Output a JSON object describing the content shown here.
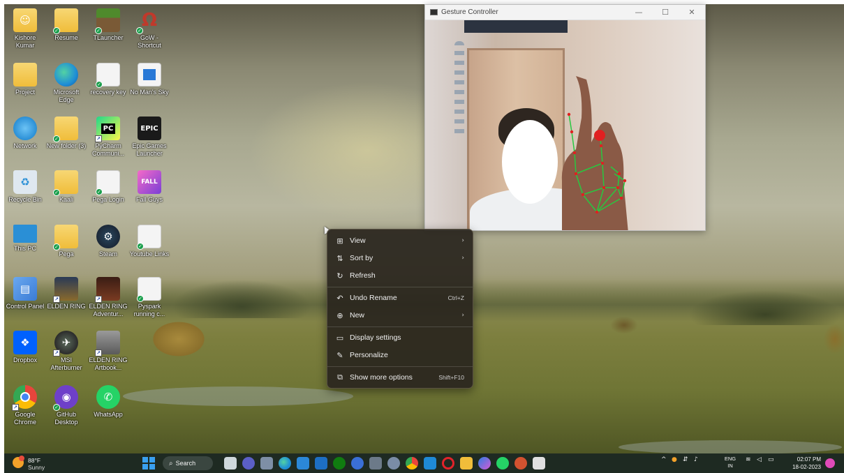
{
  "desktop_icons": [
    {
      "label": "Kishore Kumar",
      "icon": "user-folder-icon",
      "color": "#f0bd3a"
    },
    {
      "label": "Resume",
      "icon": "folder-icon",
      "color": "#f0bd3a"
    },
    {
      "label": "TLauncher",
      "icon": "minecraft-block-icon",
      "color": "#4f8a2c"
    },
    {
      "label": "GoW - Shortcut",
      "icon": "gow-omega-icon",
      "color": "#c0392b"
    },
    {
      "label": "Project",
      "icon": "folder-icon",
      "color": "#f0bd3a"
    },
    {
      "label": "Microsoft Edge",
      "icon": "edge-icon",
      "color": "#1f8fd6"
    },
    {
      "label": "recovery key",
      "icon": "document-icon",
      "color": "#f4f4f4"
    },
    {
      "label": "No Man's Sky",
      "icon": "window-app-icon",
      "color": "#2979d6"
    },
    {
      "label": "Network",
      "icon": "network-globe-icon",
      "color": "#2a8fd6"
    },
    {
      "label": "New folder (3)",
      "icon": "folder-icon",
      "color": "#f0bd3a"
    },
    {
      "label": "PyCharm Communi...",
      "icon": "pycharm-icon",
      "color": "#21d789"
    },
    {
      "label": "Epic Games Launcher",
      "icon": "epic-games-icon",
      "color": "#1a1a1a"
    },
    {
      "label": "Recycle Bin",
      "icon": "recycle-bin-icon",
      "color": "#dfe8f0"
    },
    {
      "label": "Kaali",
      "icon": "folder-icon",
      "color": "#f0bd3a"
    },
    {
      "label": "Pega Login",
      "icon": "document-icon",
      "color": "#f4f4f4"
    },
    {
      "label": "Fall Guys",
      "icon": "fall-guys-icon",
      "color": "#c44fd6"
    },
    {
      "label": "This PC",
      "icon": "monitor-icon",
      "color": "#2a8fd6"
    },
    {
      "label": "Pega",
      "icon": "folder-icon",
      "color": "#f0bd3a"
    },
    {
      "label": "Steam",
      "icon": "steam-icon",
      "color": "#1b2838"
    },
    {
      "label": "Youtube Links",
      "icon": "document-icon",
      "color": "#f4f4f4"
    },
    {
      "label": "Control Panel",
      "icon": "control-panel-icon",
      "color": "#3a7bd5"
    },
    {
      "label": "ELDEN RING",
      "icon": "elden-ring-icon",
      "color": "#4a3b1f"
    },
    {
      "label": "ELDEN RING Adventur...",
      "icon": "elden-ring-adventure-icon",
      "color": "#5a2a1f"
    },
    {
      "label": "Pyspark running c...",
      "icon": "document-icon",
      "color": "#f4f4f4"
    },
    {
      "label": "Dropbox",
      "icon": "dropbox-icon",
      "color": "#0061fe"
    },
    {
      "label": "MSI Afterburner",
      "icon": "msi-afterburner-icon",
      "color": "#2b2b2b"
    },
    {
      "label": "ELDEN RING Artbook...",
      "icon": "elden-ring-artbook-icon",
      "color": "#6b6b6b"
    },
    {
      "label": "Google Chrome",
      "icon": "chrome-icon",
      "color": "#e8453c"
    },
    {
      "label": "GitHub Desktop",
      "icon": "github-icon",
      "color": "#6e40c9"
    },
    {
      "label": "WhatsApp",
      "icon": "whatsapp-icon",
      "color": "#25d366"
    }
  ],
  "window": {
    "title": "Gesture Controller",
    "minimize_glyph": "—",
    "maximize_glyph": "☐",
    "close_glyph": "✕"
  },
  "context_menu": {
    "items": [
      {
        "label": "View",
        "icon": "grid-view-icon",
        "glyph": "⊞",
        "shortcut": "",
        "submenu": true
      },
      {
        "label": "Sort by",
        "icon": "sort-icon",
        "glyph": "⇅",
        "shortcut": "",
        "submenu": true
      },
      {
        "label": "Refresh",
        "icon": "refresh-icon",
        "glyph": "↻",
        "shortcut": "",
        "submenu": false
      },
      {
        "label": "Undo Rename",
        "icon": "undo-icon",
        "glyph": "↶",
        "shortcut": "Ctrl+Z",
        "submenu": false
      },
      {
        "label": "New",
        "icon": "new-plus-icon",
        "glyph": "⊕",
        "shortcut": "",
        "submenu": true
      },
      {
        "label": "Display settings",
        "icon": "display-icon",
        "glyph": "▭",
        "shortcut": "",
        "submenu": false
      },
      {
        "label": "Personalize",
        "icon": "pencil-icon",
        "glyph": "✎",
        "shortcut": "",
        "submenu": false
      },
      {
        "label": "Show more options",
        "icon": "more-options-icon",
        "glyph": "⧉",
        "shortcut": "Shift+F10",
        "submenu": false
      }
    ],
    "submenu_glyph": "›"
  },
  "taskbar": {
    "weather_temp": "88°F",
    "weather_condition": "Sunny",
    "search_label": "Search",
    "search_glyph": "⌕",
    "apps": [
      {
        "icon": "task-view-icon",
        "color": "#cfd8dc"
      },
      {
        "icon": "chat-icon",
        "color": "#5b5fc7"
      },
      {
        "icon": "widgets-icon",
        "color": "#7e8fa6"
      },
      {
        "icon": "edge-icon",
        "color": "#1f8fd6"
      },
      {
        "icon": "store-icon",
        "color": "#2b88d8"
      },
      {
        "icon": "mail-icon",
        "color": "#1d6fc4"
      },
      {
        "icon": "xbox-icon",
        "color": "#107c10"
      },
      {
        "icon": "media-player-icon",
        "color": "#3a6fd6"
      },
      {
        "icon": "calculator-icon",
        "color": "#6c7a89"
      },
      {
        "icon": "settings-icon",
        "color": "#7a8ca6"
      },
      {
        "icon": "chrome-icon",
        "color": "#e8453c"
      },
      {
        "icon": "vscode-icon",
        "color": "#1f8ad6"
      },
      {
        "icon": "opera-icon",
        "color": "#e2232a"
      },
      {
        "icon": "file-explorer-icon",
        "color": "#f0bd3a"
      },
      {
        "icon": "copilot-icon",
        "color": "#2f7de1"
      },
      {
        "icon": "whatsapp-icon",
        "color": "#25d366"
      },
      {
        "icon": "powerpoint-icon",
        "color": "#d35230"
      },
      {
        "icon": "window-app-icon",
        "color": "#e0e0e0"
      }
    ],
    "tray_chevron": "^",
    "language": "ENG",
    "region": "IN",
    "time": "02:07 PM",
    "date": "18-02-2023"
  },
  "colors": {
    "menu_bg": "#2a261e",
    "taskbar_bg": "#1e2a22",
    "landmark_green": "#28c840",
    "landmark_red": "#e02020"
  }
}
